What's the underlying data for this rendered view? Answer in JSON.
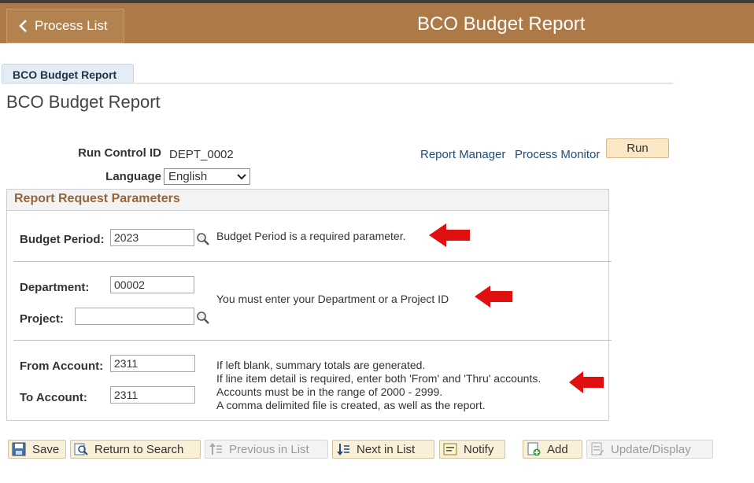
{
  "header": {
    "back_label": "Process List",
    "title": "BCO Budget Report"
  },
  "tab": {
    "label": "BCO Budget Report"
  },
  "page_title": "BCO Budget Report",
  "run_control": {
    "id_label": "Run Control ID",
    "id_value": "DEPT_0002",
    "language_label": "Language",
    "language_value": "English",
    "report_manager": "Report Manager",
    "process_monitor": "Process Monitor",
    "run_label": "Run"
  },
  "params": {
    "title": "Report Request Parameters",
    "budget_period_label": "Budget Period:",
    "budget_period_value": "2023",
    "budget_period_note": "Budget Period is a required parameter.",
    "department_label": "Department:",
    "department_value": "00002",
    "project_label": "Project:",
    "project_value": "",
    "dept_project_note": "You must enter your Department or a Project ID",
    "from_account_label": "From Account:",
    "from_account_value": "2311",
    "to_account_label": "To Account:",
    "to_account_value": "2311",
    "account_notes": [
      "If left blank, summary totals are generated.",
      "If line item detail is required, enter both 'From' and 'Thru' accounts.",
      "Accounts must be in the range of 2000 - 2999.",
      "A comma delimited file is created, as well as the report."
    ]
  },
  "toolbar": {
    "save": "Save",
    "return_to_search": "Return to Search",
    "previous_in_list": "Previous in List",
    "next_in_list": "Next in List",
    "notify": "Notify",
    "add": "Add",
    "update_display": "Update/Display"
  },
  "colors": {
    "header_bg": "#ad7a47",
    "button_bg": "#faf0d8",
    "section_title": "#94653a",
    "annotation_arrow": "#e01010"
  }
}
